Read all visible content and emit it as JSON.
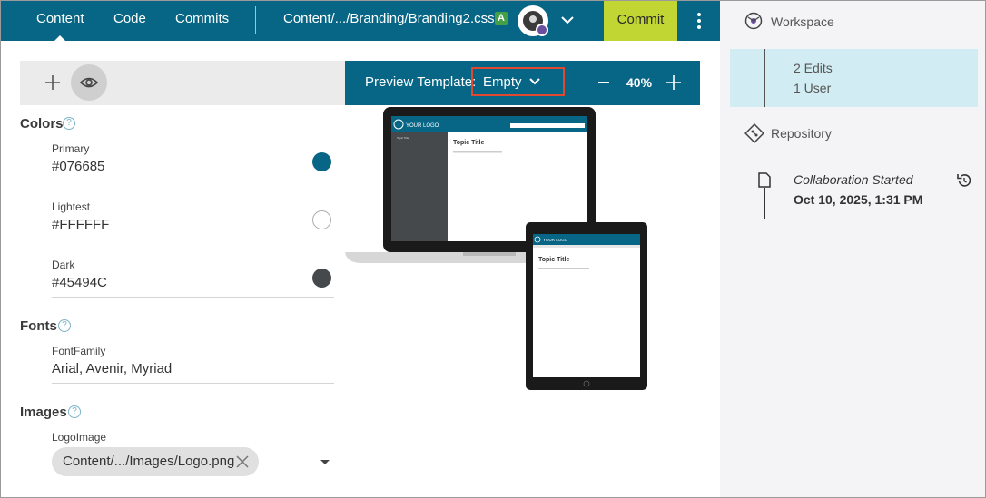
{
  "topbar": {
    "tabs": [
      {
        "label": "Content",
        "active": true
      },
      {
        "label": "Code",
        "active": false
      },
      {
        "label": "Commits",
        "active": false
      }
    ],
    "file_path": "Content/.../Branding/Branding2.css",
    "status_badge": "A",
    "commit_label": "Commit",
    "bar_color": "#076685",
    "commit_color": "#c2d633"
  },
  "preview": {
    "template_label": "Preview Template:",
    "template_value": "Empty",
    "zoom": "40%",
    "mock": {
      "logo_text": "YOUR LOGO",
      "topic_title": "Topic Title",
      "nav_item": "Topic Title"
    }
  },
  "sections": {
    "colors": {
      "title": "Colors",
      "help": "?",
      "items": [
        {
          "label": "Primary",
          "value": "#076685",
          "swatch": "#076685"
        },
        {
          "label": "Lightest",
          "value": "#FFFFFF",
          "swatch": "#FFFFFF"
        },
        {
          "label": "Dark",
          "value": "#45494C",
          "swatch": "#45494C"
        }
      ]
    },
    "fonts": {
      "title": "Fonts",
      "help": "?",
      "items": [
        {
          "label": "FontFamily",
          "value": "Arial, Avenir, Myriad"
        }
      ]
    },
    "images": {
      "title": "Images",
      "help": "?",
      "items": [
        {
          "label": "LogoImage",
          "value": "Content/.../Images/Logo.png"
        }
      ]
    }
  },
  "right_panel": {
    "workspace": {
      "title": "Workspace",
      "edits": "2 Edits",
      "users": "1 User"
    },
    "repository": {
      "title": "Repository",
      "event_title": "Collaboration Started",
      "event_date": "Oct 10, 2025, 1:31 PM"
    }
  }
}
